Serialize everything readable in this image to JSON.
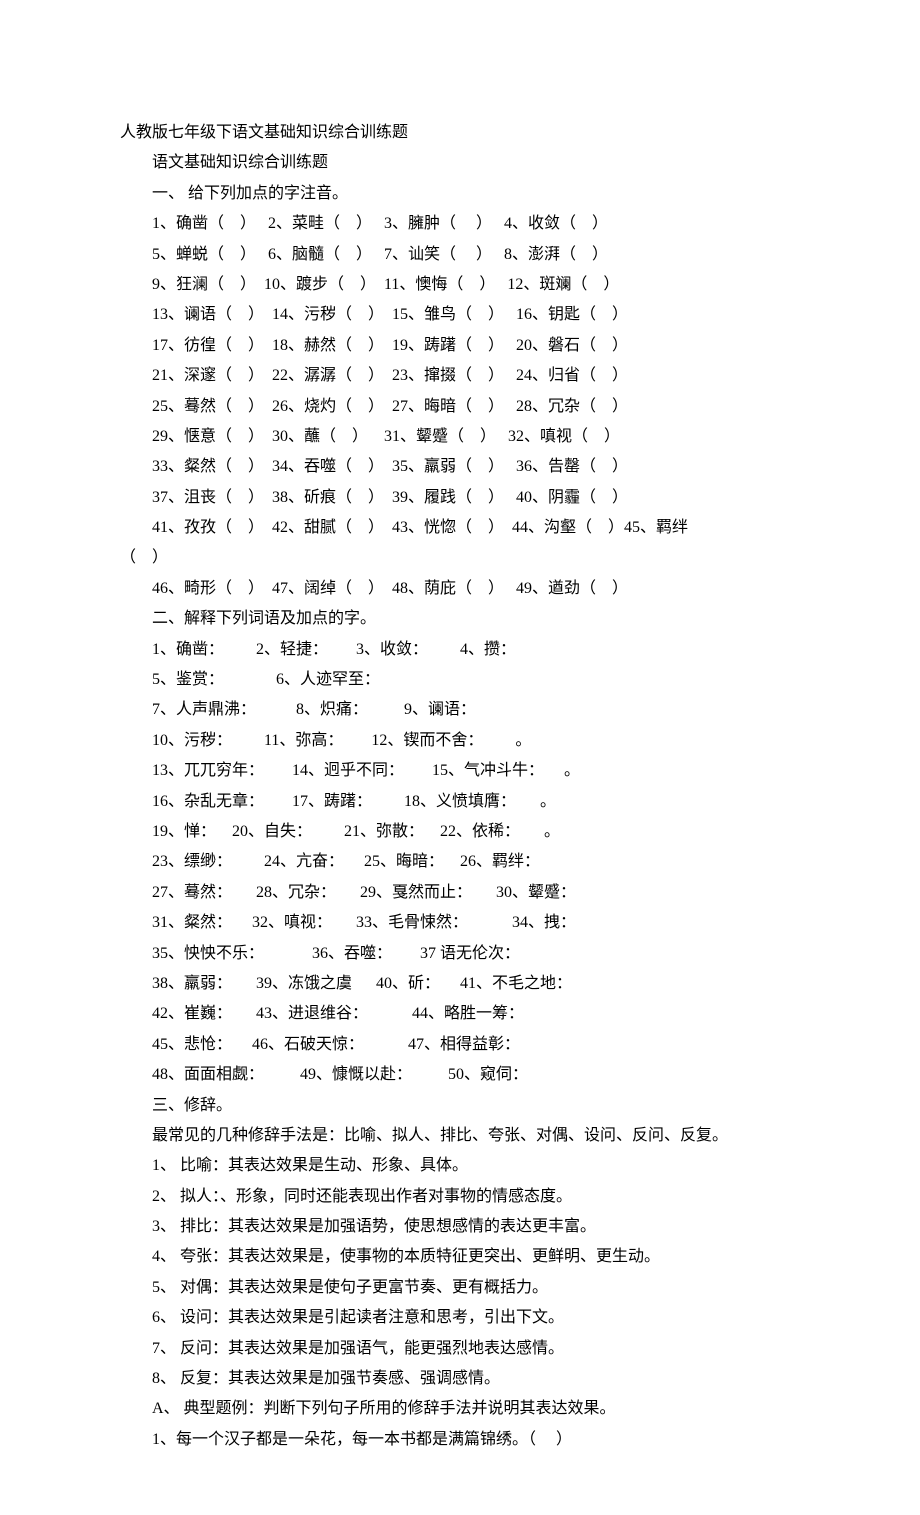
{
  "title": "人教版七年级下语文基础知识综合训练题",
  "subtitle": "语文基础知识综合训练题",
  "section1_heading": "一、 给下列加点的字注音。",
  "s1": {
    "l1": "1、确凿（    ）   2、菜畦（    ）   3、臃肿（     ）   4、收敛（    ）",
    "l2": "5、蝉蜕（    ）   6、脑髓（    ）   7、讪笑（     ）   8、澎湃（    ）",
    "l3": "9、狂澜（    ）  10、踱步（    ）  11、懊悔（    ）   12、斑斓（    ）",
    "l4": "13、谰语（    ）  14、污秽（    ）  15、雏鸟（    ）   16、钥匙（    ）",
    "l5": "17、彷徨（    ）  18、赫然（    ）  19、踌躇（    ）   20、磐石（    ）",
    "l6": "21、深邃（    ）  22、潺潺（    ）  23、撺掇（    ）   24、归省（    ）",
    "l7": "25、蓦然（    ）  26、烧灼（    ）  27、晦暗（    ）   28、冗杂（    ）",
    "l8": "29、惬意（    ）  30、蘸（    ）    31、颦蹙（    ）   32、嗔视（    ）",
    "l9": "33、粲然（    ）  34、吞噬（    ）  35、羸弱（    ）   36、告罄（    ）",
    "l10": "37、沮丧（    ）  38、斫痕（    ）  39、履践（    ）   40、阴霾（    ）",
    "l11": "41、孜孜（    ）  42、甜腻（    ）  43、恍惚（    ）  44、沟壑（    ）45、羁绊",
    "l11b": "（    ）",
    "l12": "46、畸形（    ）  47、阔绰（    ）  48、荫庇（    ）   49、遒劲（    ）"
  },
  "section2_heading": "二、解释下列词语及加点的字。",
  "s2": {
    "l1": "1、确凿：        2、轻捷：       3、收敛：        4、攒：",
    "l2": "5、鉴赏：             6、人迹罕至：",
    "l3": "7、人声鼎沸：          8、炽痛：         9、谰语：",
    "l4": "10、污秽：        11、弥高：       12、锲而不舍：        。",
    "l5": "13、兀兀穷年：       14、迥乎不同：       15、气冲斗牛：     。",
    "l6": "16、杂乱无章：       17、踌躇：        18、义愤填膺：      。",
    "l7": "19、惮：    20、自失：        21、弥散：    22、依稀：      。",
    "l8": "23、缥缈：        24、亢奋：     25、晦暗：    26、羁绊：",
    "l9": "27、蓦然：      28、冗杂：      29、戛然而止：      30、颦蹙：",
    "l10": "31、粲然：     32、嗔视：      33、毛骨悚然：           34、拽：",
    "l11": "35、怏怏不乐：            36、吞噬：       37 语无伦次：",
    "l12": "38、羸弱：      39、冻饿之虞      40、斫：     41、不毛之地：",
    "l13": "42、崔巍：      43、进退维谷：           44、略胜一筹：",
    "l14": "45、悲怆：     46、石破天惊：           47、相得益彰：",
    "l15": "48、面面相觑：         49、慷慨以赴：         50、窥伺："
  },
  "section3_heading": "三、修辞。",
  "s3": {
    "intro": "最常见的几种修辞手法是：比喻、拟人、排比、夸张、对偶、设问、反问、反复。",
    "item1": "1、 比喻：其表达效果是生动、形象、具体。",
    "item2": "2、 拟人：、形象，同时还能表现出作者对事物的情感态度。",
    "item3": "3、 排比：其表达效果是加强语势，使思想感情的表达更丰富。",
    "item4": "4、 夸张：其表达效果是，使事物的本质特征更突出、更鲜明、更生动。",
    "item5": "5、 对偶：其表达效果是使句子更富节奏、更有概括力。",
    "item6": "6、 设问：其表达效果是引起读者注意和思考，引出下文。",
    "item7": "7、 反问：其表达效果是加强语气，能更强烈地表达感情。",
    "item8": "8、 反复：其表达效果是加强节奏感、强调感情。",
    "exA": "A、 典型题例：判断下列句子所用的修辞手法并说明其表达效果。",
    "ex1": "1、每一个汉子都是一朵花，每一本书都是满篇锦绣。（     ）"
  }
}
